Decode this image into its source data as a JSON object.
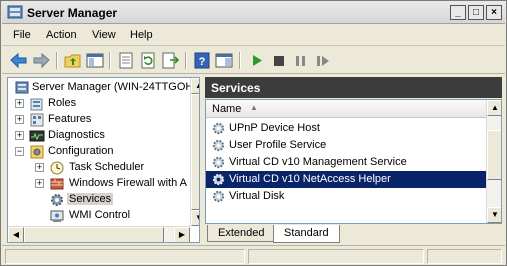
{
  "window": {
    "title": "Server Manager",
    "controls": {
      "minimize": "_",
      "maximize": "□",
      "close": "×"
    }
  },
  "menu": [
    "File",
    "Action",
    "View",
    "Help"
  ],
  "toolbar": {
    "buttons": [
      "back-arrow-icon",
      "forward-arrow-icon",
      "up-folder-icon",
      "show-hide-tree-icon",
      "properties-icon",
      "refresh-icon",
      "export-list-icon",
      "help-icon",
      "console-view-icon",
      "start-service-icon",
      "stop-service-icon",
      "pause-service-icon",
      "restart-service-icon"
    ]
  },
  "tree": {
    "root": "Server Manager (WIN-24TTGOH",
    "items": [
      {
        "label": "Roles",
        "expander": "+"
      },
      {
        "label": "Features",
        "expander": "+"
      },
      {
        "label": "Diagnostics",
        "expander": "+"
      },
      {
        "label": "Configuration",
        "expander": "−"
      },
      {
        "label": "Task Scheduler",
        "expander": "+"
      },
      {
        "label": "Windows Firewall with A",
        "expander": "+"
      },
      {
        "label": "Services",
        "expander": ""
      },
      {
        "label": "WMI Control",
        "expander": ""
      }
    ]
  },
  "services_pane": {
    "title": "Services",
    "column": "Name",
    "rows": [
      "UPnP Device Host",
      "User Profile Service",
      "Virtual CD v10 Management Service",
      "Virtual CD v10 NetAccess Helper",
      "Virtual Disk"
    ],
    "selected": "Virtual CD v10 NetAccess Helper"
  },
  "tabs": [
    "Extended",
    "Standard"
  ],
  "active_tab": "Standard"
}
